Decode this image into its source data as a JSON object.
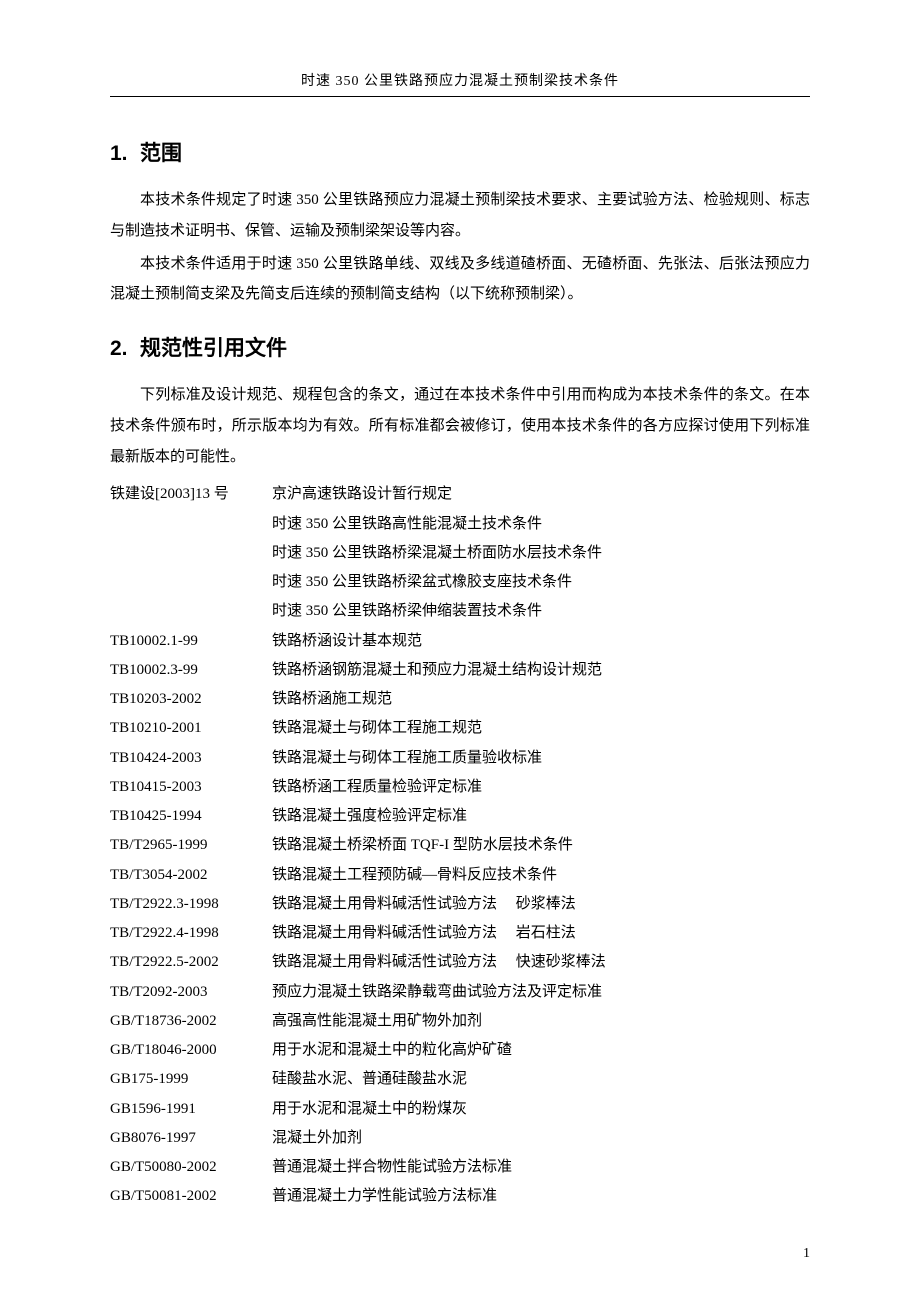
{
  "header": {
    "title": "时速 350 公里铁路预应力混凝土预制梁技术条件"
  },
  "section1": {
    "number": "1.",
    "title": "范围",
    "paras": [
      "本技术条件规定了时速 350 公里铁路预应力混凝土预制梁技术要求、主要试验方法、检验规则、标志与制造技术证明书、保管、运输及预制梁架设等内容。",
      "本技术条件适用于时速 350 公里铁路单线、双线及多线道碴桥面、无碴桥面、先张法、后张法预应力混凝土预制简支梁及先简支后连续的预制简支结构（以下统称预制梁）。"
    ]
  },
  "section2": {
    "number": "2.",
    "title": "规范性引用文件",
    "paras": [
      "下列标准及设计规范、规程包含的条文，通过在本技术条件中引用而构成为本技术条件的条文。在本技术条件颁布时，所示版本均为有效。所有标准都会被修订，使用本技术条件的各方应探讨使用下列标准最新版本的可能性。"
    ],
    "refs": [
      {
        "code": "铁建设[2003]13 号",
        "desc": "京沪高速铁路设计暂行规定"
      },
      {
        "code": "",
        "desc": "时速 350 公里铁路高性能混凝土技术条件"
      },
      {
        "code": "",
        "desc": "时速 350 公里铁路桥梁混凝土桥面防水层技术条件"
      },
      {
        "code": "",
        "desc": "时速 350 公里铁路桥梁盆式橡胶支座技术条件"
      },
      {
        "code": "",
        "desc": "时速 350 公里铁路桥梁伸缩装置技术条件"
      },
      {
        "code": "TB10002.1-99",
        "desc": "铁路桥涵设计基本规范"
      },
      {
        "code": "TB10002.3-99",
        "desc": "铁路桥涵钢筋混凝土和预应力混凝土结构设计规范"
      },
      {
        "code": "TB10203-2002",
        "desc": "铁路桥涵施工规范"
      },
      {
        "code": "TB10210-2001",
        "desc": "铁路混凝土与砌体工程施工规范"
      },
      {
        "code": "TB10424-2003",
        "desc": "铁路混凝土与砌体工程施工质量验收标准"
      },
      {
        "code": "TB10415-2003",
        "desc": "铁路桥涵工程质量检验评定标准"
      },
      {
        "code": "TB10425-1994",
        "desc": "铁路混凝土强度检验评定标准"
      },
      {
        "code": "TB/T2965-1999",
        "desc": "铁路混凝土桥梁桥面 TQF-I 型防水层技术条件"
      },
      {
        "code": "TB/T3054-2002",
        "desc": "铁路混凝土工程预防碱—骨料反应技术条件"
      },
      {
        "code": "TB/T2922.3-1998",
        "desc": "铁路混凝土用骨料碱活性试验方法　 砂浆棒法"
      },
      {
        "code": "TB/T2922.4-1998",
        "desc": "铁路混凝土用骨料碱活性试验方法　 岩石柱法"
      },
      {
        "code": "TB/T2922.5-2002",
        "desc": "铁路混凝土用骨料碱活性试验方法　 快速砂浆棒法"
      },
      {
        "code": "TB/T2092-2003",
        "desc": "预应力混凝土铁路梁静载弯曲试验方法及评定标准"
      },
      {
        "code": "GB/T18736-2002",
        "desc": "高强高性能混凝土用矿物外加剂"
      },
      {
        "code": "GB/T18046-2000",
        "desc": "用于水泥和混凝土中的粒化高炉矿碴"
      },
      {
        "code": "GB175-1999",
        "desc": "硅酸盐水泥、普通硅酸盐水泥"
      },
      {
        "code": "GB1596-1991",
        "desc": "用于水泥和混凝土中的粉煤灰"
      },
      {
        "code": "GB8076-1997",
        "desc": "混凝土外加剂"
      },
      {
        "code": "GB/T50080-2002",
        "desc": "普通混凝土拌合物性能试验方法标准"
      },
      {
        "code": "GB/T50081-2002",
        "desc": "普通混凝土力学性能试验方法标准"
      }
    ]
  },
  "pageNumber": "1"
}
